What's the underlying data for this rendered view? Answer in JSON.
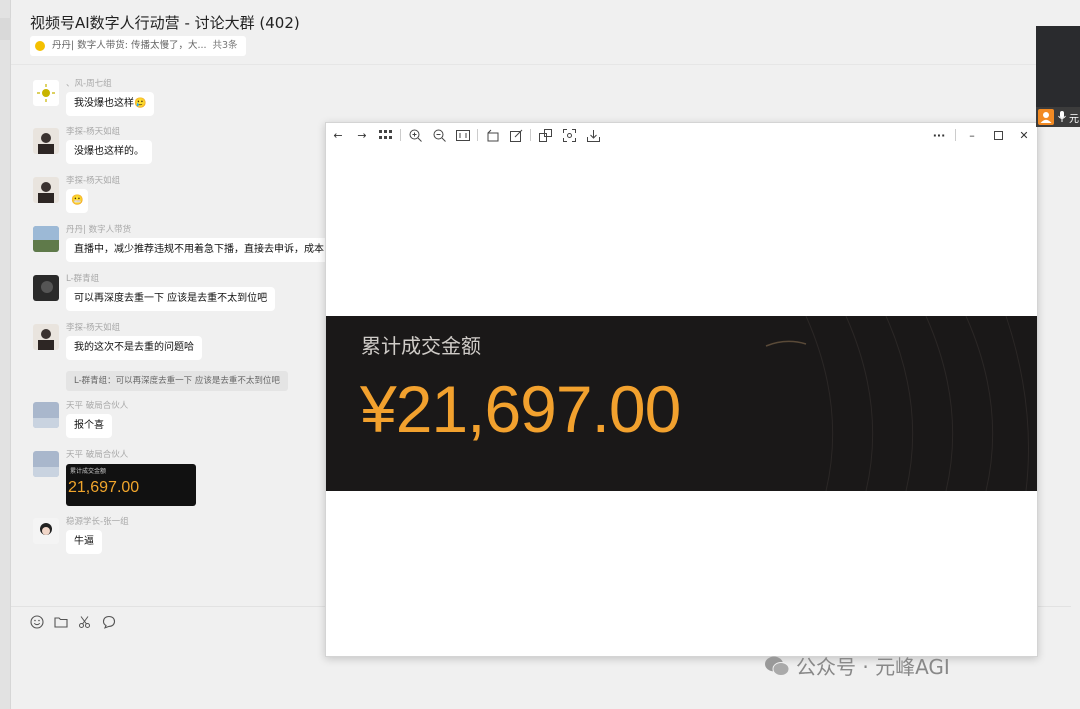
{
  "chat": {
    "title": "视频号AI数字人行动营 - 讨论大群 (402)",
    "notice": {
      "text": "丹丹| 数字人带货: 传播太慢了，大...",
      "count": "共3条"
    }
  },
  "messages": [
    {
      "sender": "、风-周七组",
      "text": "我没爆也这样🥲"
    },
    {
      "sender": "李探-杨天如组",
      "text": "没爆也这样的。"
    },
    {
      "sender": "李探-杨天如组",
      "text": "😬"
    },
    {
      "sender": "丹丹| 数字人带货",
      "text": "直播中，减少推荐违规不用着急下播，直接去申诉，成本"
    },
    {
      "sender": "L-群青组",
      "text": "可以再深度去重一下 应该是去重不太到位吧"
    },
    {
      "sender": "李探-杨天如组",
      "text": "我的这次不是去重的问题哈",
      "quote": "L-群青组：可以再深度去重一下 应该是去重不太到位吧"
    },
    {
      "sender": "天平 破局合伙人",
      "text": "报个喜"
    },
    {
      "sender": "天平 破局合伙人",
      "image_label": "累计成交金额",
      "image_value": "21,697.00"
    },
    {
      "sender": "稳源学长-张一组",
      "text": "牛逼"
    }
  ],
  "viewer": {
    "panel_label": "累计成交金额",
    "panel_value": "¥21,697.00",
    "more": "···"
  },
  "video": {
    "name": "元"
  },
  "watermark": {
    "text": "公众号 · 元峰AGI"
  },
  "colors": {
    "accent": "#f2a12e",
    "panel_bg": "#1a1818"
  }
}
